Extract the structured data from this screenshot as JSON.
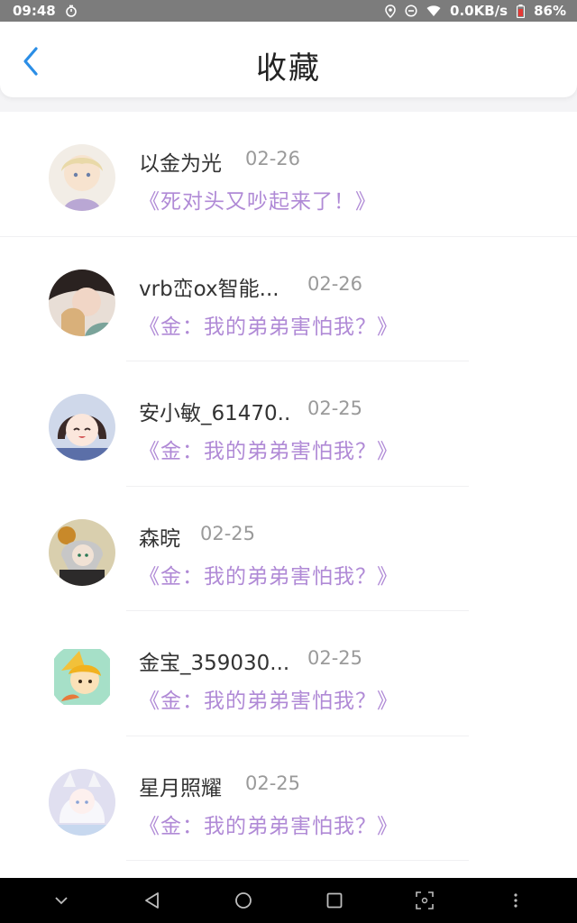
{
  "status_bar": {
    "time": "09:48",
    "network_speed": "0.0KB/s",
    "battery": "86%",
    "icons": [
      "timer-icon",
      "location-icon",
      "dnd-icon",
      "wifi-icon",
      "battery-icon"
    ]
  },
  "header": {
    "title": "收藏",
    "back_icon": "chevron-left-icon"
  },
  "favorites": [
    {
      "name": "以金为光",
      "date": "02-26",
      "title": "《死对头又吵起来了！》"
    },
    {
      "name": "vrb峦ox智能...",
      "date": "02-26",
      "title": "《金：我的弟弟害怕我？》"
    },
    {
      "name": "安小敏_61470..",
      "date": "02-25",
      "title": "《金：我的弟弟害怕我？》"
    },
    {
      "name": "森晥",
      "date": "02-25",
      "title": "《金：我的弟弟害怕我？》"
    },
    {
      "name": "金宝_359030...",
      "date": "02-25",
      "title": "《金：我的弟弟害怕我？》"
    },
    {
      "name": "星月照耀",
      "date": "02-25",
      "title": "《金：我的弟弟害怕我？》"
    }
  ],
  "colors": {
    "accent": "#2b8ee6",
    "title_purple": "#b08ad6",
    "date_gray": "#9a9a9a",
    "status_bar_bg": "#7c7c7c",
    "nav_bar_bg": "#000000"
  },
  "nav_bar": {
    "icons": [
      "collapse-icon",
      "back-triangle-icon",
      "home-circle-icon",
      "recents-square-icon",
      "screenshot-icon",
      "more-dots-icon"
    ]
  }
}
